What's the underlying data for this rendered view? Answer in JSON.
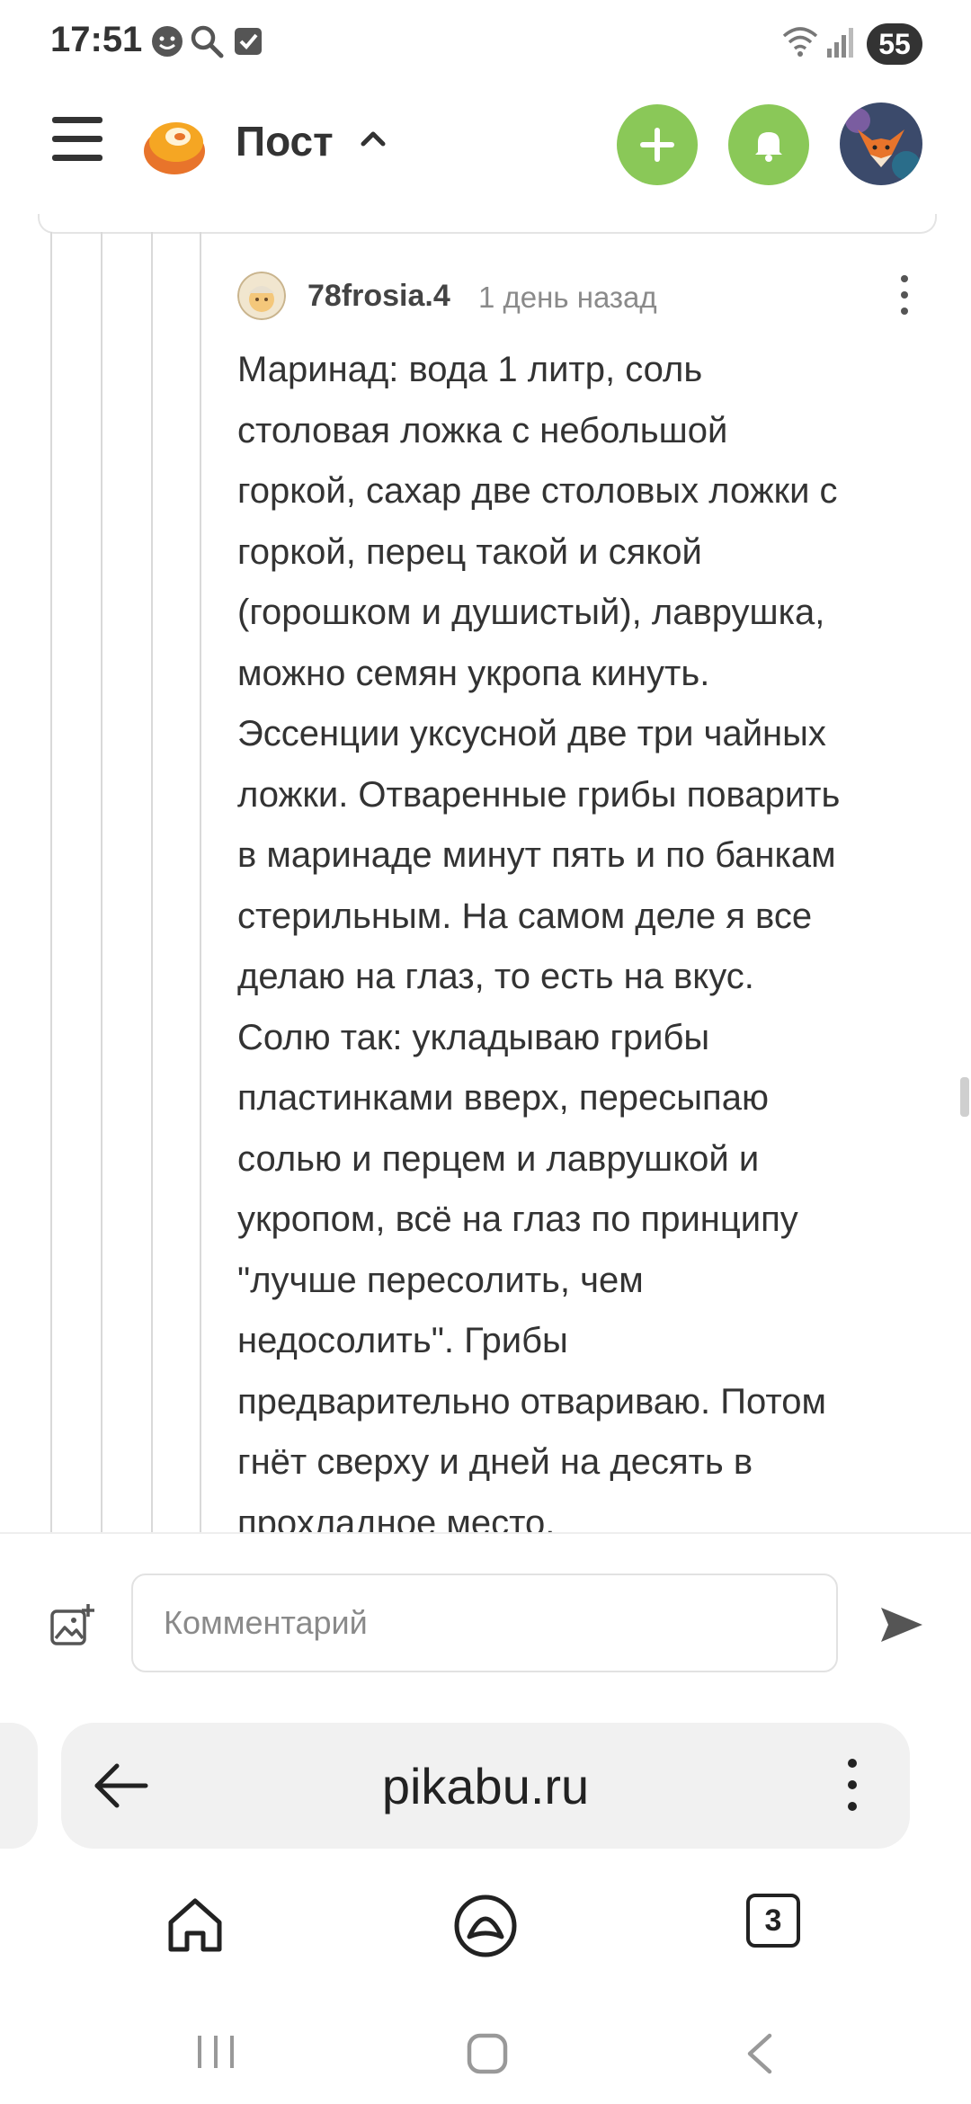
{
  "status_bar": {
    "time": "17:51",
    "icons": [
      "chat-face-icon",
      "search-icon",
      "checkbox-icon"
    ],
    "right_icons": [
      "wifi-icon",
      "signal-icon"
    ],
    "battery": "55"
  },
  "header": {
    "menu_icon": "hamburger-icon",
    "logo": "pikabu-logo",
    "title": "Пост",
    "caret": "chevron-up-icon",
    "add_icon": "plus-icon",
    "bell_icon": "bell-icon",
    "accent_color": "#8ac858"
  },
  "comment": {
    "author": "78frosia.4",
    "time": "1 день назад",
    "lines": [
      "Маринад: вода 1 литр, соль",
      "столовая ложка с небольшой",
      "горкой, сахар две столовых ложки с",
      "горкой, перец такой и сякой",
      "(горошком и душистый), лаврушка,",
      "можно семян укропа кинуть.",
      "Эссенции уксусной две три чайных",
      "ложки. Отваренные грибы поварить",
      "в маринаде минут пять и по банкам",
      "стерильным. На самом деле я все",
      "делаю на глаз, то есть на вкус.",
      "Солю так: укладываю грибы",
      "пластинками вверх, пересыпаю",
      "солью и перцем и лаврушкой и",
      "укропом, всё на глаз по принципу",
      "\"лучше пересолить, чем",
      "недосолить\". Грибы",
      "предварительно отвариваю. Потом",
      "гнёт сверху и дней на десять в",
      "прохладное место."
    ]
  },
  "comment_bar": {
    "placeholder": "Комментарий"
  },
  "browser": {
    "url": "pikabu.ru",
    "tab_count": "3"
  }
}
